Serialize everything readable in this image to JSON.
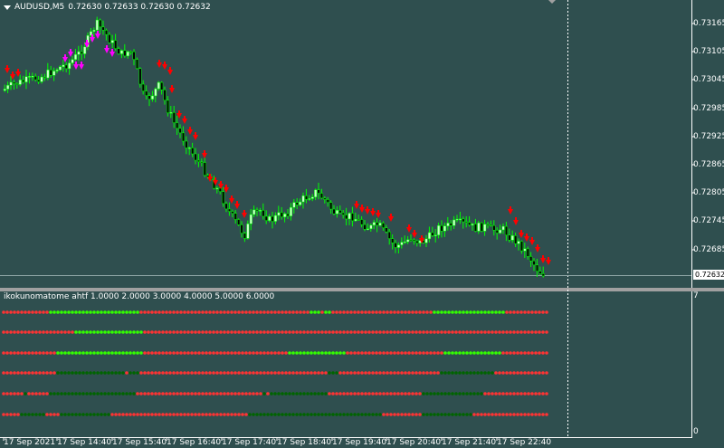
{
  "header": {
    "symbol": "AUDUSD,M5",
    "ohlc": "0.72630 0.72633 0.72630 0.72632"
  },
  "price_axis": {
    "ticks": [
      "0.73165",
      "0.73105",
      "0.73045",
      "0.72985",
      "0.72925",
      "0.72865",
      "0.72805",
      "0.72745",
      "0.72685"
    ],
    "current_price": "0.72632"
  },
  "time_axis": {
    "ticks": [
      "17 Sep 2021",
      "17 Sep 14:40",
      "17 Sep 15:40",
      "17 Sep 16:40",
      "17 Sep 17:40",
      "17 Sep 18:40",
      "17 Sep 19:40",
      "17 Sep 20:40",
      "17 Sep 21:40",
      "17 Sep 22:40"
    ]
  },
  "indicator": {
    "title": "ikokunomatome ahtf 1.0000 2.0000 3.0000 4.0000 5.0000 6.0000",
    "axis_top": "7",
    "axis_bottom": "0"
  },
  "colors": {
    "background": "#2f4f4f",
    "bull_candle": "#ccffcc",
    "bear_candle": "#000000",
    "wick_bull": "#00ff00",
    "arrow_red": "#ff0000",
    "arrow_magenta": "#ff00ff",
    "dot_red": "#ff3333",
    "dot_lime": "#33ff00",
    "dot_dark_green": "#006400"
  },
  "icons": {
    "header_dropdown": "triangle-down-icon",
    "scroll_marker": "triangle-down-icon"
  }
}
